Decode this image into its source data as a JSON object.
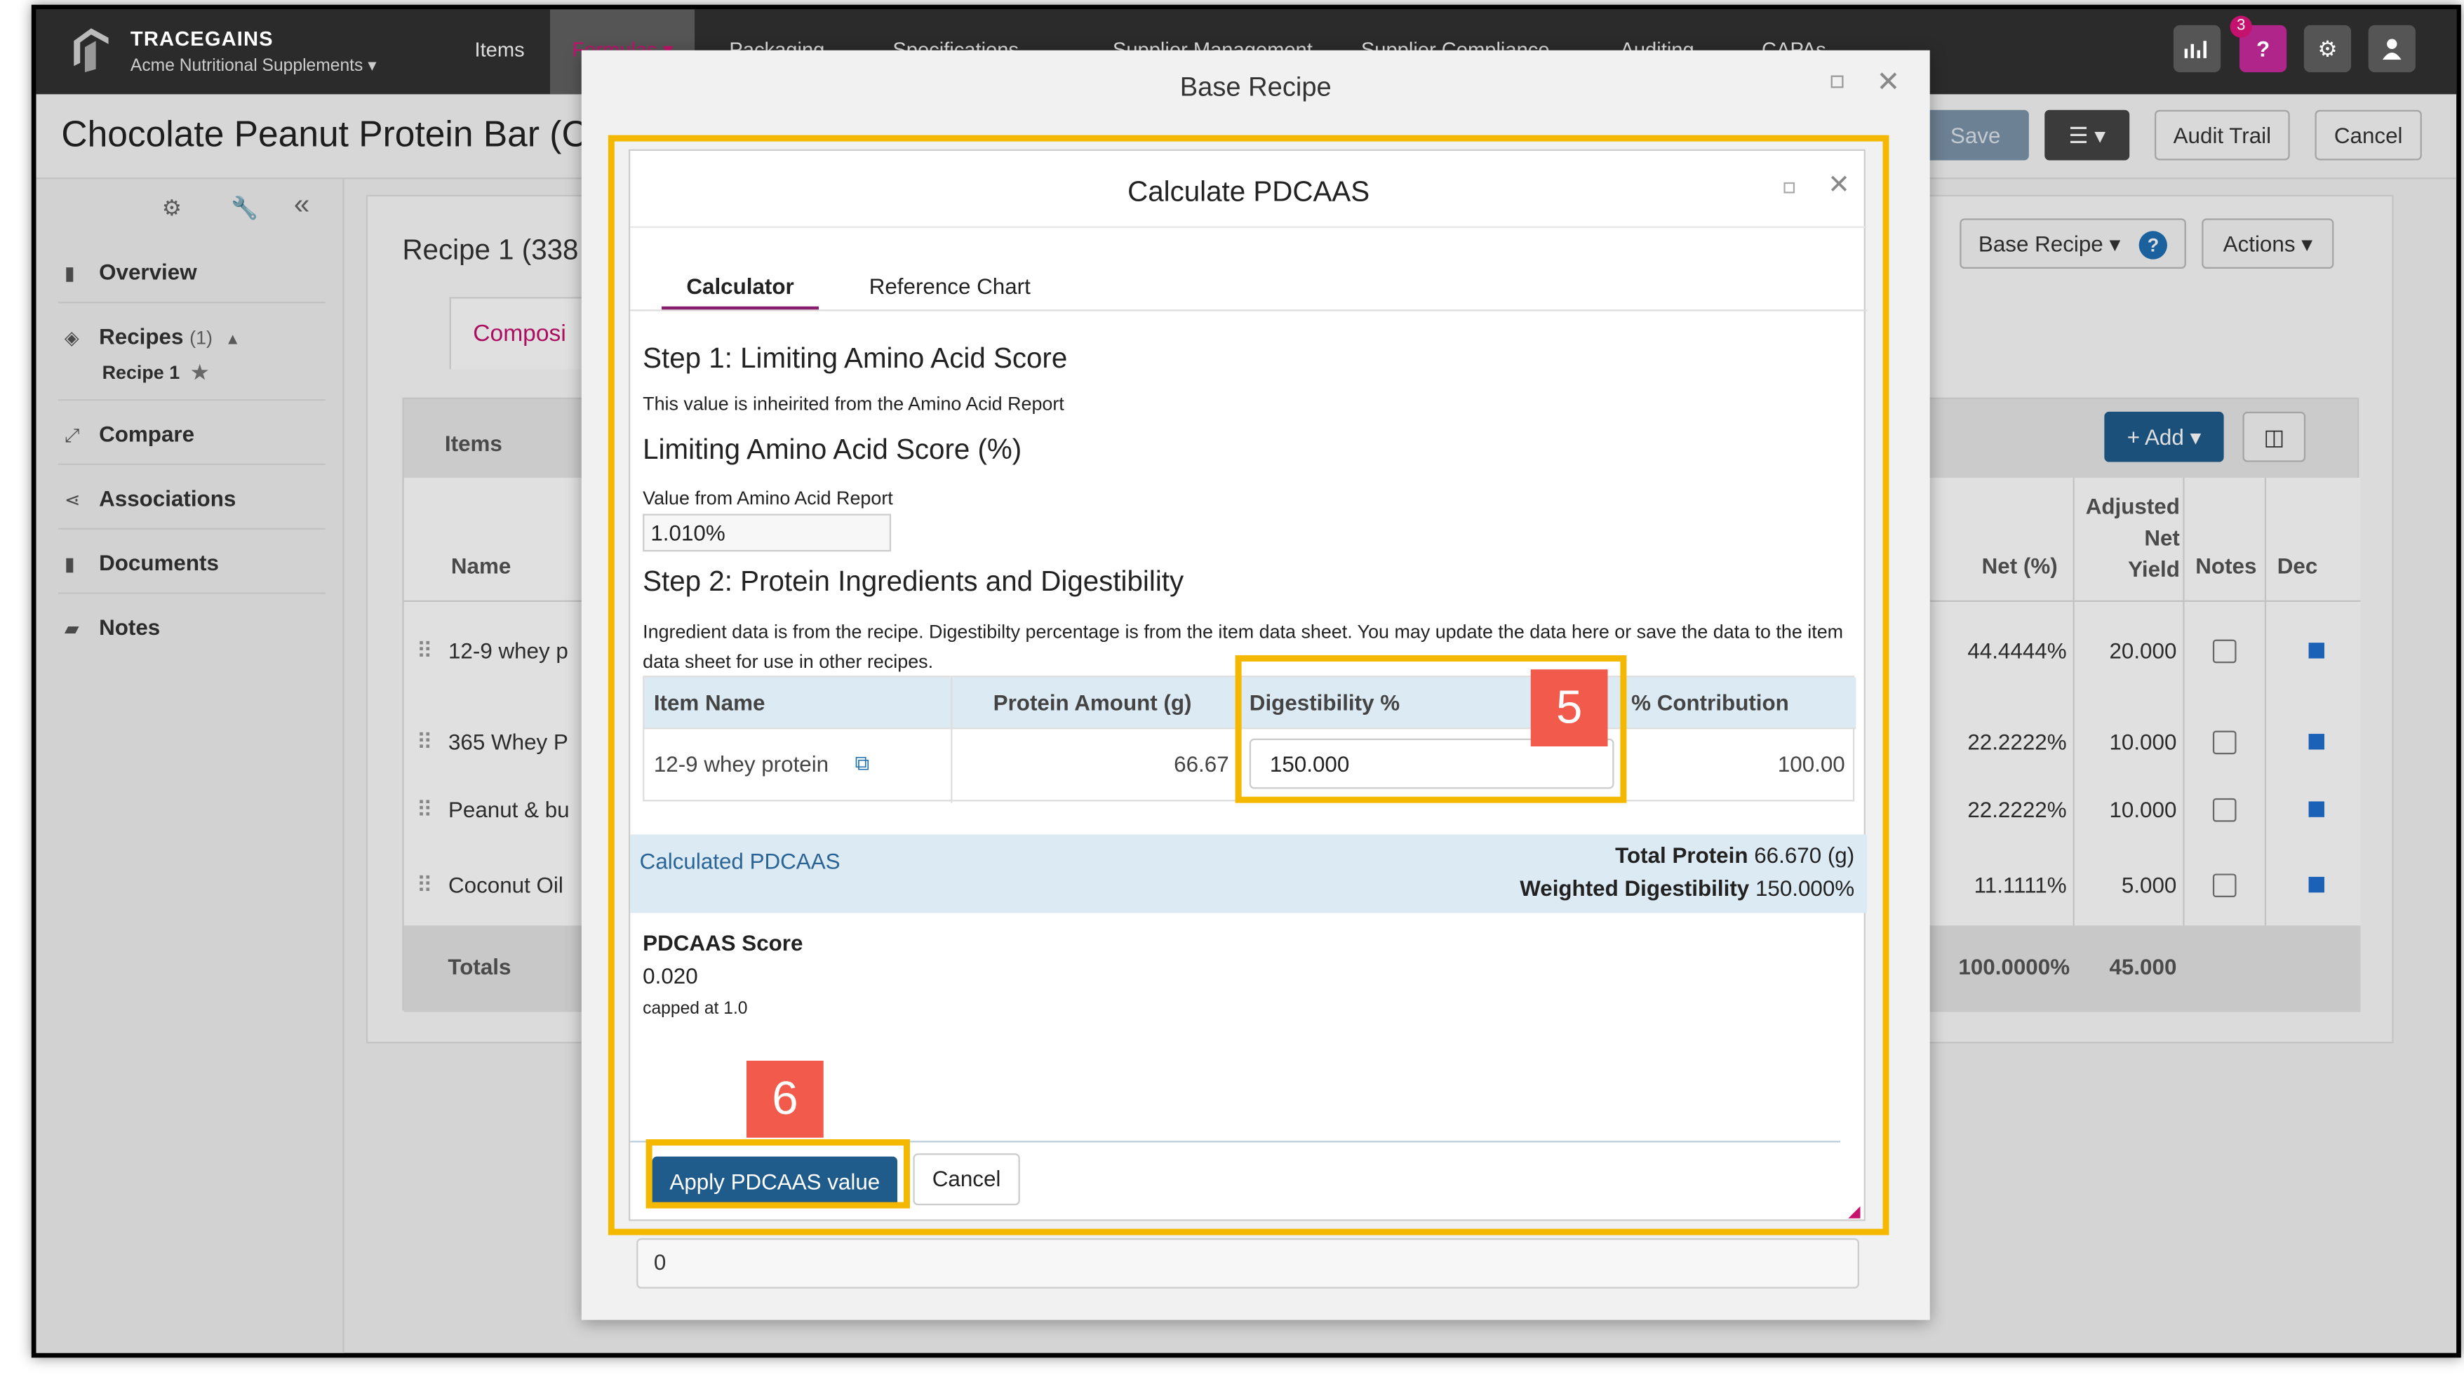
{
  "topbar": {
    "brand": "TRACEGAINS",
    "company": "Acme Nutritional Supplements",
    "nav": [
      "Items",
      "Formulas",
      "Packaging",
      "Specifications",
      "Supplier Management",
      "Supplier Compliance",
      "Auditing",
      "CAPAs"
    ],
    "notif_count": "3"
  },
  "page": {
    "title": "Chocolate Peanut Protein Bar (C",
    "save": "Save",
    "audit": "Audit Trail",
    "cancel": "Cancel"
  },
  "sidebar": {
    "items": [
      {
        "label": "Overview",
        "icon": "file-icon"
      },
      {
        "label": "Recipes",
        "icon": "layers-icon",
        "count": "(1)"
      },
      {
        "label": "Compare",
        "icon": "compare-icon"
      },
      {
        "label": "Associations",
        "icon": "share-icon"
      },
      {
        "label": "Documents",
        "icon": "document-icon"
      },
      {
        "label": "Notes",
        "icon": "note-icon"
      }
    ],
    "sub": "Recipe 1"
  },
  "content": {
    "recipe_title": "Recipe 1 (338",
    "tab": "Composi",
    "base_recipe": "Base Recipe",
    "actions": "Actions",
    "add": "+ Add",
    "items_label": "Items",
    "name_col": "Name",
    "net_col": "Net (%)",
    "adj_col": [
      "Adjusted",
      "Net",
      "Yield"
    ],
    "notes_col": "Notes",
    "dec_col": "Dec",
    "rows": [
      {
        "name": "12-9 whey p",
        "net": "44.4444%",
        "adj": "20.000"
      },
      {
        "name": "365 Whey P",
        "net": "22.2222%",
        "adj": "10.000"
      },
      {
        "name": "Peanut & bu",
        "net": "22.2222%",
        "adj": "10.000"
      },
      {
        "name": "Coconut Oil",
        "net": "11.1111%",
        "adj": "5.000"
      }
    ],
    "totals": {
      "label": "Totals",
      "net": "100.0000%",
      "adj": "45.000"
    }
  },
  "base_modal": {
    "title": "Base Recipe",
    "bottom_value": "0"
  },
  "pdcaas": {
    "title": "Calculate PDCAAS",
    "tabs": [
      "Calculator",
      "Reference Chart"
    ],
    "step1": "Step 1: Limiting Amino Acid Score",
    "step1_note": "This value is inheirited from the Amino Acid Report",
    "laas_title": "Limiting Amino Acid Score (%)",
    "laas_label": "Value from Amino Acid Report",
    "laas_value": "1.010%",
    "step2": "Step 2: Protein Ingredients and Digestibility",
    "step2_note": "Ingredient data is from the recipe. Digestibilty percentage is from the item data sheet. You may update the data here or save the data to the item data sheet for use in other recipes.",
    "cols": [
      "Item Name",
      "Protein Amount (g)",
      "Digestibility %",
      "% Contribution"
    ],
    "row": {
      "item": "12-9 whey protein",
      "protein": "66.67",
      "digest": "150.000",
      "contribution": "100.00"
    },
    "calc_label": "Calculated PDCAAS",
    "total_protein_label": "Total Protein",
    "total_protein": "66.670 (g)",
    "wd_label": "Weighted Digestibility",
    "wd": "150.000%",
    "score_label": "PDCAAS Score",
    "score": "0.020",
    "capped": "capped at 1.0",
    "apply": "Apply PDCAAS value",
    "cancel": "Cancel"
  },
  "callouts": {
    "five": "5",
    "six": "6"
  },
  "colors": {
    "highlight": "#f5b800",
    "badge": "#f25a4c",
    "primary": "#1f5c8b",
    "accent": "#c4126e"
  }
}
